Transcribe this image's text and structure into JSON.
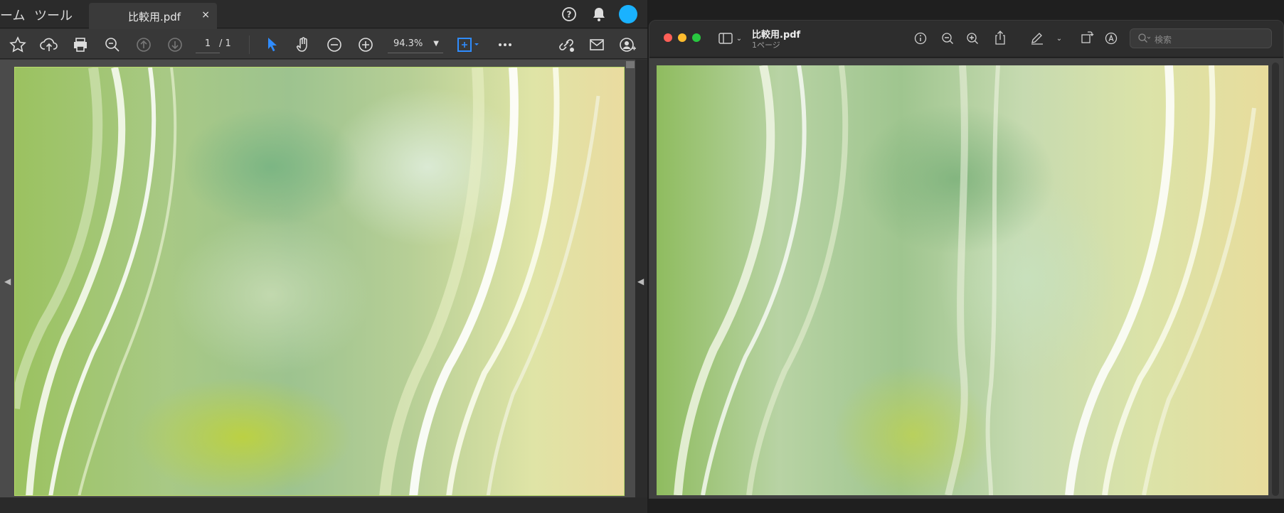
{
  "left_app": {
    "menu": {
      "item_partial": "ーム",
      "item_tools": "ツール"
    },
    "tab": {
      "title": "比較用.pdf",
      "close": "×"
    },
    "toolbar": {
      "icons": [
        "star-icon",
        "cloud-upload-icon",
        "print-icon",
        "search-zoom-icon",
        "page-up-icon",
        "page-down-icon",
        "select-arrow-icon",
        "hand-tool-icon",
        "zoom-out-icon",
        "zoom-in-icon",
        "fit-page-icon",
        "more-icon",
        "link-icon",
        "mail-icon",
        "user-add-icon"
      ],
      "page_current": "1",
      "page_total": "/ 1",
      "zoom": "94.3%"
    },
    "header_icons": [
      "help-icon",
      "bell-icon",
      "avatar"
    ],
    "accent_color": "#2f8cff",
    "avatar_color": "#1ab2ff"
  },
  "right_app": {
    "window": {
      "title": "比較用.pdf",
      "subtitle": "1ページ"
    },
    "traffic_lights": {
      "close": "#ff5f57",
      "minimize": "#febc2e",
      "zoom": "#28c840"
    },
    "toolbar_icons": [
      "sidebar-icon",
      "chevron-down-icon",
      "info-icon",
      "zoom-out-icon",
      "zoom-in-icon",
      "share-icon",
      "pen-icon",
      "chevron-down-icon",
      "rotate-icon",
      "markup-icon"
    ],
    "search": {
      "placeholder": "検索"
    }
  }
}
